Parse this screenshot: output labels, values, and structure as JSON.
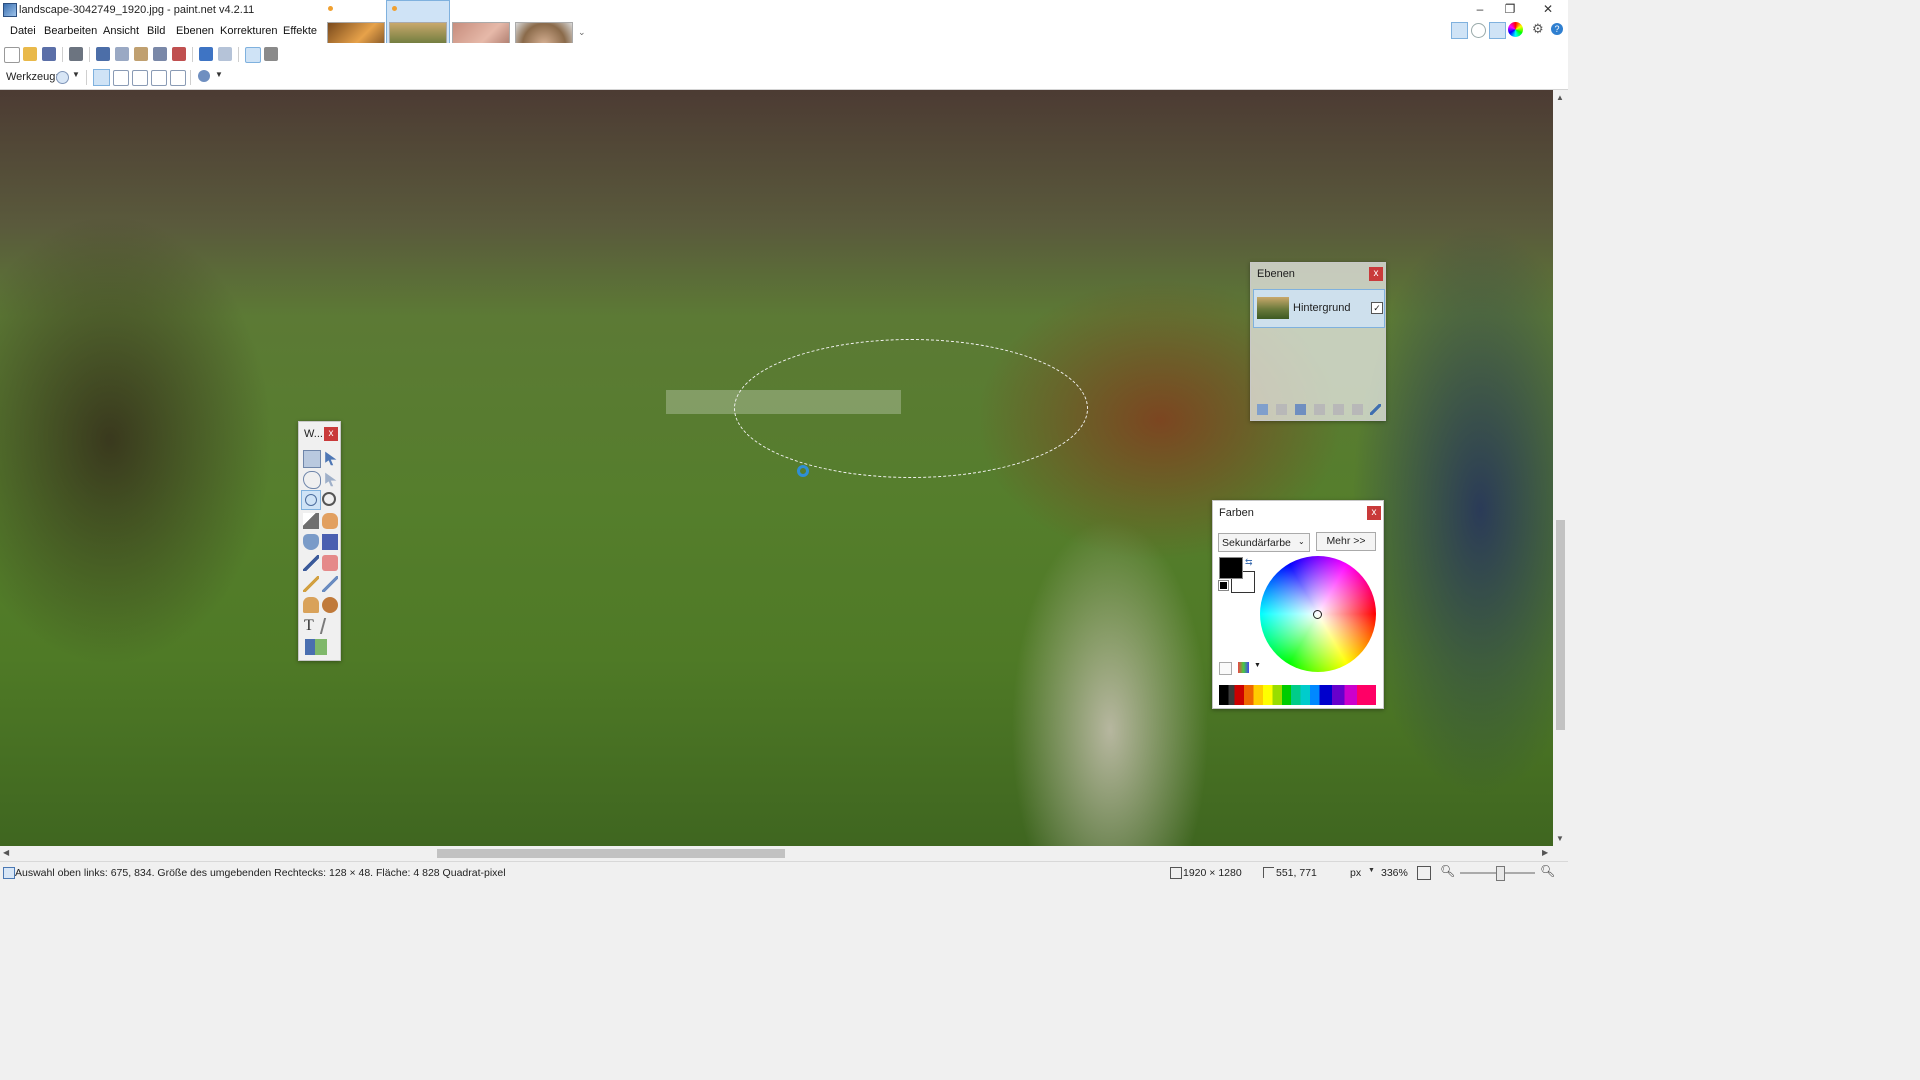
{
  "window": {
    "title": "landscape-3042749_1920.jpg - paint.net v4.2.11",
    "minimize": "–",
    "maximize": "❐",
    "close": "✕"
  },
  "menu": [
    "Datei",
    "Bearbeiten",
    "Ansicht",
    "Bild",
    "Ebenen",
    "Korrekturen",
    "Effekte"
  ],
  "toolbar2": {
    "tool_label": "Werkzeug:"
  },
  "tools_panel": {
    "title": "W...",
    "close": "x",
    "text_tool": "T"
  },
  "layers_panel": {
    "title": "Ebenen",
    "close": "x",
    "layers": [
      {
        "name": "Hintergrund",
        "visible": true
      }
    ]
  },
  "colors_panel": {
    "title": "Farben",
    "close": "x",
    "select_value": "Sekundärfarbe",
    "more_button": "Mehr >>",
    "primary_color": "#000000",
    "secondary_color": "#ffffff"
  },
  "statusbar": {
    "selection_info": "Auswahl oben links: 675, 834. Größe des umgebenden Rechtecks: 128 × 48. Fläche: 4 828 Quadrat-pixel",
    "image_size": "1920 × 1280",
    "cursor_pos": "551, 771",
    "unit": "px",
    "zoom": "336%"
  },
  "colors": {
    "accent": "#2f8fd6",
    "close_red": "#c93a3a"
  }
}
